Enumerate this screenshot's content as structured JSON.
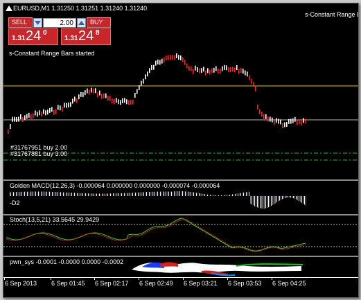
{
  "header": {
    "symbol_line": "EURUSD,M1  1.31250 1.31251 1.31240 1.31240",
    "indicator_name": "s-Constant Range Bars"
  },
  "trade_panel": {
    "sell_label": "SELL",
    "buy_label": "BUY",
    "lot_value": "2.00",
    "sell_price": {
      "prefix": "1.31",
      "big": "24",
      "sup": "0"
    },
    "buy_price": {
      "prefix": "1.31",
      "big": "24",
      "sup": "8"
    }
  },
  "main_chart": {
    "status_text": "s-Constant Range Bars started",
    "orders": [
      "#31767951 buy 2.00",
      "#31767881 buy 3.00"
    ],
    "colors": {
      "up_bar": "#ffffff",
      "down_bar": "#ff2020",
      "level_line": "#ffd700",
      "price_line": "#c0c0c0",
      "order_line": "#00c000"
    }
  },
  "macd": {
    "label": "Golden MACD(12,26,3) -0.000064 0.000000 0.000000 -0.000074 -0.000064",
    "sub_label": "-D2"
  },
  "stoch": {
    "label": "Stoch(13,5,21) 33.5645 29.9429"
  },
  "bottom_indicator": {
    "label": "pwn_sys -0.0001 -0.0000 0.0000 -0.0002"
  },
  "time_axis": [
    "6 Sep 2013",
    "6 Sep 01:45",
    "6 Sep 02:17",
    "6 Sep 02:49",
    "6 Sep 03:21",
    "6 Sep 03:53",
    "6 Sep 04:25"
  ]
}
